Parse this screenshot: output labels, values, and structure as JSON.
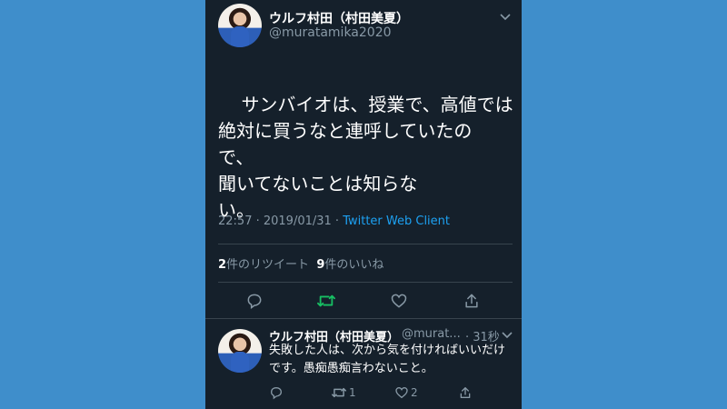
{
  "tweet": {
    "author_name": "ウルフ村田（村田美夏）",
    "author_handle": "@muratamika2020",
    "text": "サンバイオは、授業で、高値では\n絶対に買うなと連呼していたの\nで、\n聞いてないことは知らな\nい。",
    "time": "22:57 · 2019/01/31 · ",
    "client": "Twitter Web Client",
    "retweet_count": "2",
    "retweet_label": "件のリツイート",
    "like_count": "9",
    "like_label": "件のいいね"
  },
  "reply": {
    "author_name": "ウルフ村田（村田美夏）",
    "author_handle": "@murat...",
    "time": "· 31秒",
    "text": "失敗した人は、次から気を付ければいいだけです。愚痴愚痴言わないこと。",
    "retweet_count": "1",
    "like_count": "2"
  },
  "colors": {
    "background": "#3f8ecb",
    "panel": "#15202b",
    "retweet_active": "#17bf63",
    "link": "#1da1f2",
    "muted": "#8899a6"
  },
  "icons": {
    "reply": "reply-icon",
    "retweet": "retweet-icon",
    "like": "heart-icon",
    "share": "share-icon",
    "more": "chevron-down-icon"
  }
}
